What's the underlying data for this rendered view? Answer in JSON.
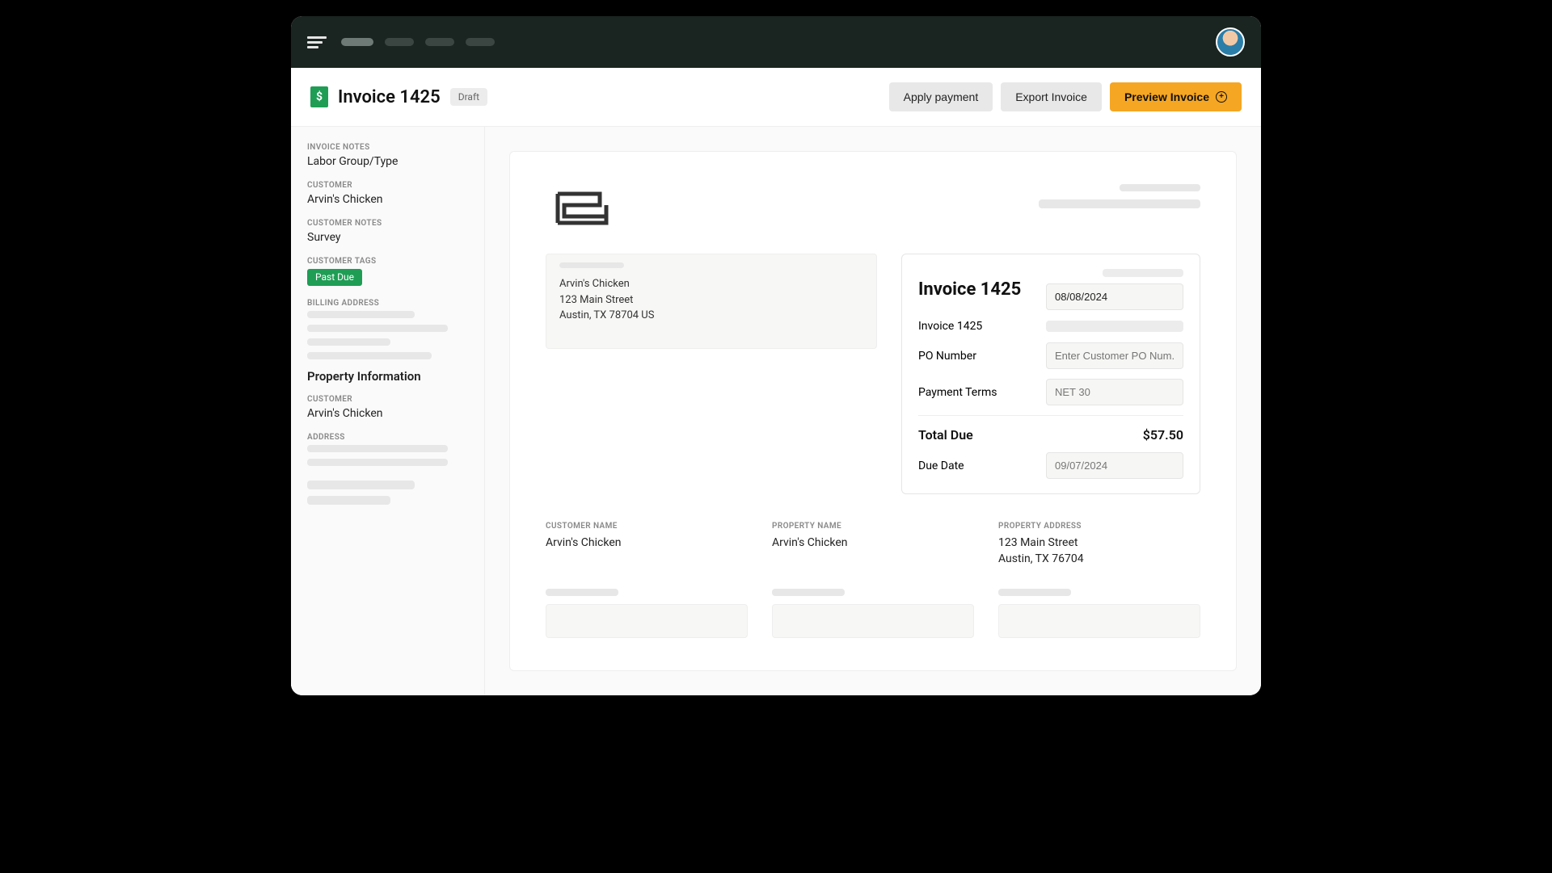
{
  "header": {
    "page_title": "Invoice 1425",
    "status_badge": "Draft",
    "actions": {
      "apply_payment": "Apply payment",
      "export": "Export Invoice",
      "preview": "Preview Invoice"
    }
  },
  "sidebar": {
    "invoice_notes_label": "INVOICE NOTES",
    "invoice_notes": "Labor Group/Type",
    "customer_label": "CUSTOMER",
    "customer": "Arvin's Chicken",
    "customer_notes_label": "CUSTOMER NOTES",
    "customer_notes": "Survey",
    "customer_tags_label": "CUSTOMER TAGS",
    "customer_tag": "Past Due",
    "billing_address_label": "BILLING ADDRESS",
    "property_heading": "Property Information",
    "property_customer_label": "CUSTOMER",
    "property_customer": "Arvin's Chicken",
    "address_label": "ADDRESS"
  },
  "billTo": {
    "name": "Arvin's Chicken",
    "street": "123 Main Street",
    "citystate": "Austin, TX 78704 US"
  },
  "invoicePanel": {
    "title": "Invoice 1425",
    "date": "08/08/2024",
    "number_label": "Invoice 1425",
    "po_label": "PO Number",
    "po_placeholder": "Enter Customer PO Num...",
    "terms_label": "Payment Terms",
    "terms_value": "NET 30",
    "total_label": "Total Due",
    "total_value": "$57.50",
    "due_label": "Due Date",
    "due_value": "09/07/2024"
  },
  "columns": {
    "customer_name_label": "CUSTOMER NAME",
    "customer_name": "Arvin's Chicken",
    "property_name_label": "PROPERTY NAME",
    "property_name": "Arvin's Chicken",
    "property_address_label": "PROPERTY ADDRESS",
    "property_address_line1": "123 Main Street",
    "property_address_line2": "Austin, TX 76704"
  }
}
